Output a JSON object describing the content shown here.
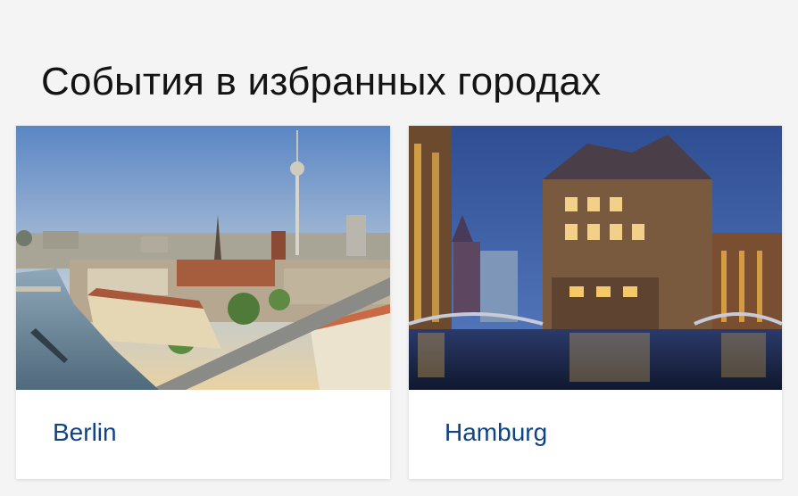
{
  "section": {
    "title": "События в избранных городах"
  },
  "cities": [
    {
      "name": "Berlin",
      "image": "berlin-skyline-photo"
    },
    {
      "name": "Hamburg",
      "image": "hamburg-speicherstadt-photo"
    }
  ],
  "colors": {
    "page_background": "#f4f4f4",
    "card_background": "#ffffff",
    "link": "#0e4486",
    "title": "#141414"
  }
}
